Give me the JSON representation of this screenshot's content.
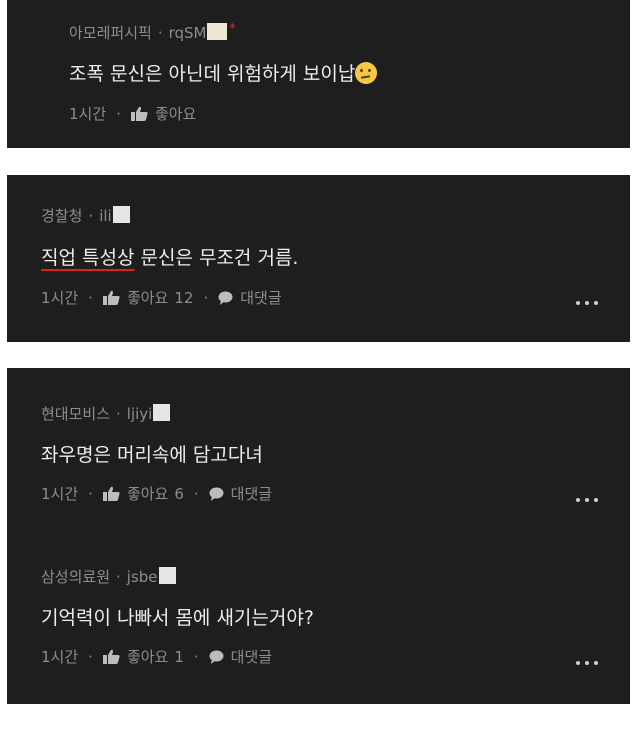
{
  "comments": [
    {
      "author": "아모레퍼시픽",
      "handle": "rqSM",
      "text": "조폭 문신은 아닌데 위험하게 보이납",
      "time": "1시간",
      "like_label": "좋아요"
    },
    {
      "author": "경찰청",
      "handle": "ili",
      "text_underlined": "직업 특성상",
      "text_rest": " 문신은 무조건 거름.",
      "time": "1시간",
      "like_label": "좋아요",
      "like_count": "12",
      "reply_label": "대댓글"
    },
    {
      "author": "현대모비스",
      "handle": "ljiyi",
      "text": "좌우명은 머리속에 담고다녀",
      "time": "1시간",
      "like_label": "좋아요",
      "like_count": "6",
      "reply_label": "대댓글"
    },
    {
      "author": "삼성의료원",
      "handle": "jsbe",
      "text": "기억력이 나빠서 몸에 새기는거야?",
      "time": "1시간",
      "like_label": "좋아요",
      "like_count": "1",
      "reply_label": "대댓글"
    }
  ],
  "separator": "·",
  "icons": {
    "like": "thumbs-up-icon",
    "reply": "speech-bubble-icon",
    "more": "more-dots-icon",
    "emoji": "thinking-face-icon"
  },
  "colors": {
    "card_bg": "#1e1e1e",
    "meta_text": "#8d8d8d",
    "body_text": "#ececec",
    "underline": "#e02020"
  }
}
